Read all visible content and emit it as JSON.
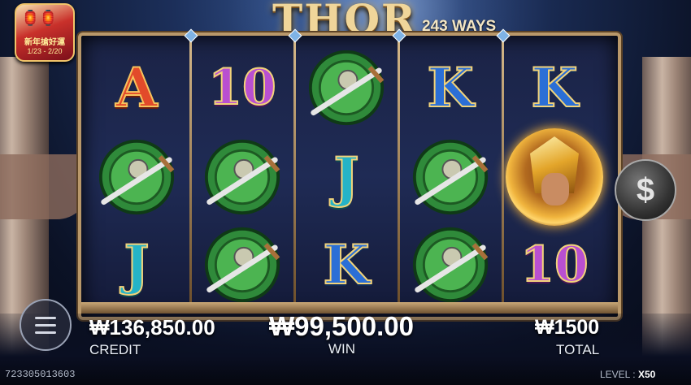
{
  "header": {
    "logo_text": "THOR",
    "ways_text": "243 WAYS"
  },
  "promo_badge": {
    "line1": "新年搶好運",
    "line2": "1/23 - 2/20"
  },
  "reels": [
    [
      "A",
      "shield",
      "J"
    ],
    [
      "10",
      "shield",
      "shield"
    ],
    [
      "shield",
      "J",
      "K"
    ],
    [
      "K",
      "shield",
      "shield"
    ],
    [
      "K",
      "thor",
      "10"
    ]
  ],
  "hud": {
    "credit_value": "₩136,850.00",
    "credit_label": "CREDIT",
    "win_value": "₩99,500.00",
    "win_label": "WIN",
    "total_value": "₩1500",
    "total_label": "TOTAL"
  },
  "buttons": {
    "bet_symbol": "$"
  },
  "footer": {
    "round_id": "723305013603",
    "level_label": "LEVEL :",
    "level_value": "X50"
  },
  "colors": {
    "frame_gold": "#b9986a",
    "accent_gold": "#f0d69a",
    "background_night": "#0b1226"
  }
}
